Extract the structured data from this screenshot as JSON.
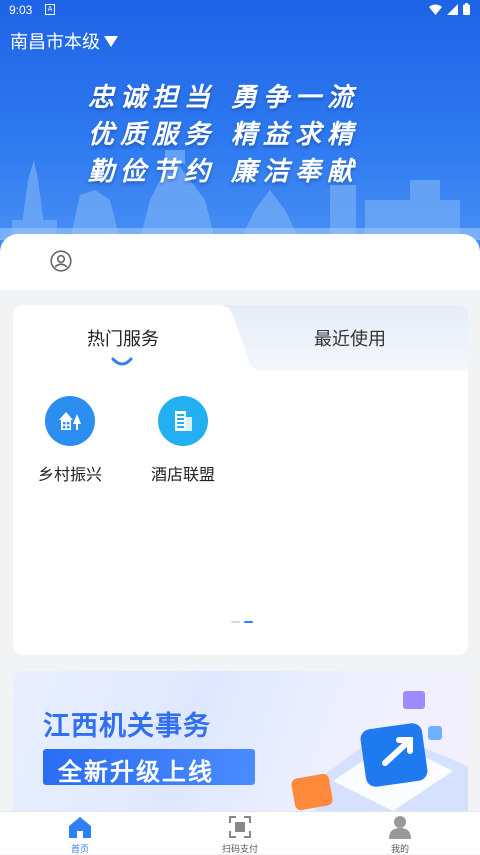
{
  "status_bar": {
    "time": "9:03",
    "notification_glyph": "A"
  },
  "header": {
    "region_label": "南昌市本级"
  },
  "hero": {
    "slogan_lines": [
      "忠诚担当 勇争一流",
      "优质服务 精益求精",
      "勤俭节约 廉洁奉献"
    ]
  },
  "services": {
    "tabs": [
      {
        "label": "热门服务",
        "active": true
      },
      {
        "label": "最近使用",
        "active": false
      }
    ],
    "items": [
      {
        "label": "乡村振兴",
        "icon": "village-icon",
        "color": "#2b8ef0"
      },
      {
        "label": "酒店联盟",
        "icon": "building-icon",
        "color": "#22b0f2"
      }
    ]
  },
  "banner": {
    "title": "江西机关事务",
    "subtitle": "全新升级上线"
  },
  "bottom_nav": [
    {
      "label": "首页",
      "icon": "home-icon",
      "active": true
    },
    {
      "label": "扫码支付",
      "icon": "scan-icon",
      "active": false
    },
    {
      "label": "我的",
      "icon": "user-icon",
      "active": false
    }
  ],
  "colors": {
    "primary": "#2a6df3",
    "hero": "#1e63e6",
    "active_nav": "#2f7ff5"
  }
}
